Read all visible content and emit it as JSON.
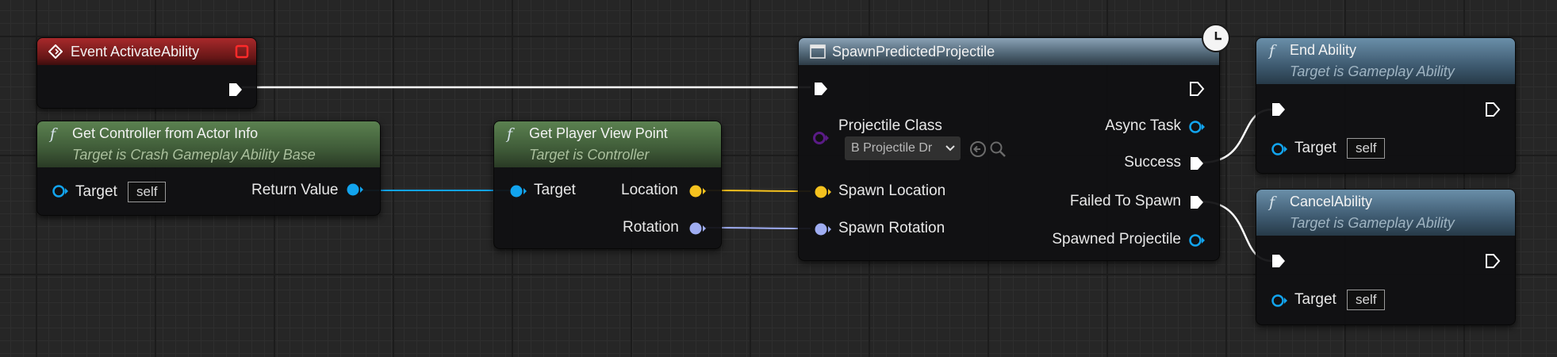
{
  "nodes": {
    "event": {
      "title": "Event ActivateAbility"
    },
    "get_controller": {
      "title": "Get Controller from Actor Info",
      "subtitle": "Target is Crash Gameplay Ability Base",
      "target_label": "Target",
      "target_default": "self",
      "return_label": "Return Value"
    },
    "get_view": {
      "title": "Get Player View Point",
      "subtitle": "Target is Controller",
      "target_label": "Target",
      "location_label": "Location",
      "rotation_label": "Rotation"
    },
    "spawn": {
      "title": "SpawnPredictedProjectile",
      "projectile_class_label": "Projectile Class",
      "projectile_class_value": "B Projectile Dr",
      "spawn_location_label": "Spawn Location",
      "spawn_rotation_label": "Spawn Rotation",
      "async_task_label": "Async Task",
      "success_label": "Success",
      "failed_label": "Failed To Spawn",
      "spawned_label": "Spawned Projectile"
    },
    "end_ability": {
      "title": "End Ability",
      "subtitle": "Target is Gameplay Ability",
      "target_label": "Target",
      "target_default": "self"
    },
    "cancel_ability": {
      "title": "CancelAbility",
      "subtitle": "Target is Gameplay Ability",
      "target_label": "Target",
      "target_default": "self"
    }
  },
  "colors": {
    "exec": "#ffffff",
    "object": "#12a4ee",
    "vector": "#f5c21e",
    "rotator": "#9fadf2",
    "class": "#5a1b86",
    "latent_icon": "#ffffff"
  },
  "icons": {
    "event_node": "diamond-event-icon",
    "delegate": "red-square-delegate-icon",
    "function": "function-f-icon",
    "latent": "clock-icon",
    "browse": "arrow-left-circle-icon",
    "search": "magnifier-icon",
    "dropdown": "chevron-down-icon"
  }
}
